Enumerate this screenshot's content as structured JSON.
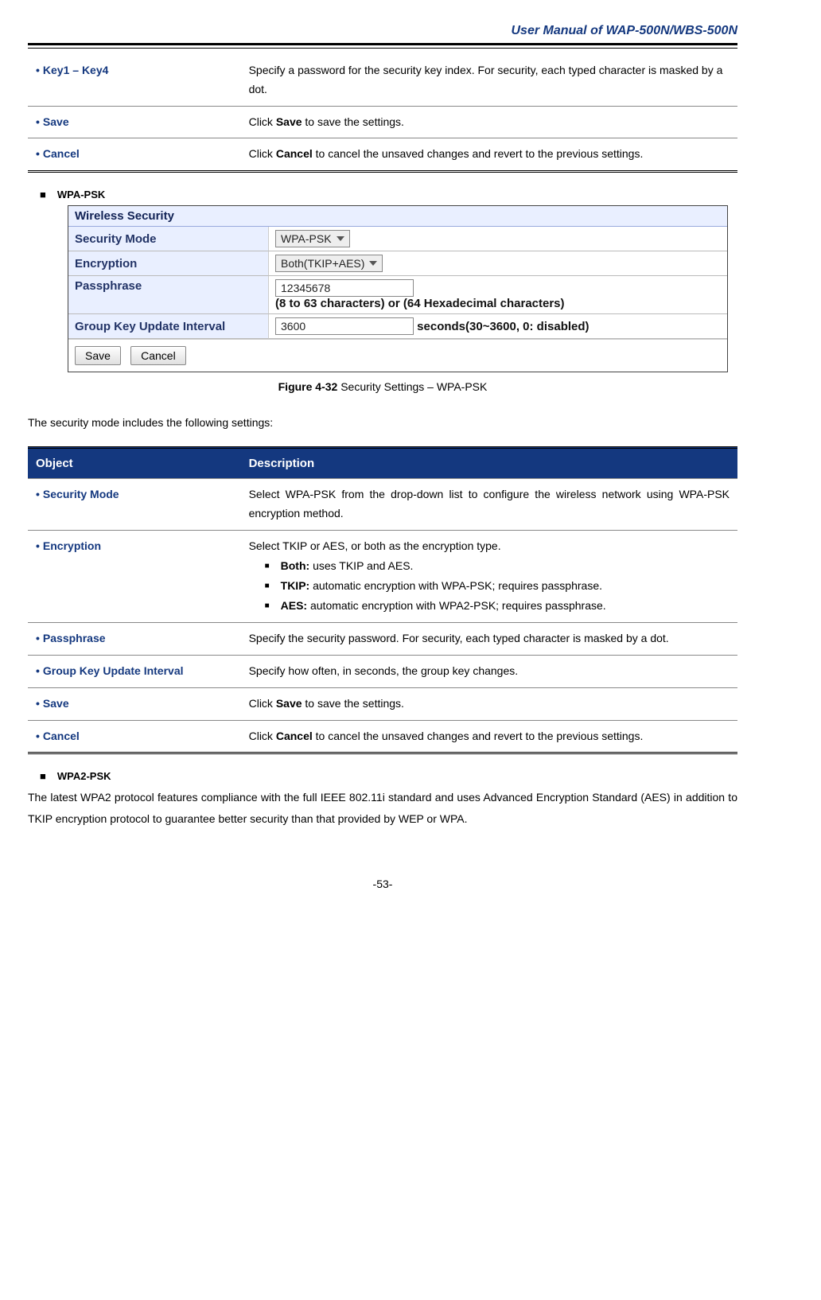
{
  "header": {
    "title": "User  Manual  of  WAP-500N/WBS-500N"
  },
  "table1": {
    "rows": [
      {
        "obj": "Key1 – Key4",
        "desc": "Specify a password for the security key index. For security, each typed character is masked by a dot."
      },
      {
        "obj": "Save",
        "desc_pre": "Click ",
        "desc_bold": "Save",
        "desc_post": " to save the settings."
      },
      {
        "obj": "Cancel",
        "desc_pre": "Click ",
        "desc_bold": "Cancel",
        "desc_post": " to cancel the unsaved changes and revert to the previous settings."
      }
    ]
  },
  "section1": {
    "title": "WPA-PSK"
  },
  "figure": {
    "header": "Wireless Security",
    "rows": {
      "security_mode": {
        "label": "Security Mode",
        "value": "WPA-PSK"
      },
      "encryption": {
        "label": "Encryption",
        "value": "Both(TKIP+AES)"
      },
      "passphrase": {
        "label": "Passphrase",
        "value": "12345678",
        "hint": "(8 to 63 characters) or (64 Hexadecimal characters)"
      },
      "interval": {
        "label": "Group Key Update Interval",
        "value": "3600",
        "hint": "seconds(30~3600, 0: disabled)"
      }
    },
    "buttons": {
      "save": "Save",
      "cancel": "Cancel"
    },
    "caption_bold": "Figure 4-32",
    "caption_rest": " Security Settings – WPA-PSK"
  },
  "intro2": "The security mode includes the following settings:",
  "table2": {
    "head_obj": "Object",
    "head_desc": "Description",
    "rows": {
      "security_mode": {
        "obj": "Security Mode",
        "desc": "Select  WPA-PSK  from  the  drop-down  list  to  configure  the  wireless network using WPA-PSK encryption method."
      },
      "encryption": {
        "obj": "Encryption",
        "lead": "Select TKIP or AES, or both as the encryption type.",
        "items": [
          {
            "b": "Both:",
            "t": " uses TKIP and AES."
          },
          {
            "b": "TKIP:",
            "t": " automatic encryption with WPA-PSK; requires passphrase."
          },
          {
            "b": "AES:",
            "t": " automatic encryption with WPA2-PSK; requires passphrase."
          }
        ]
      },
      "passphrase": {
        "obj": "Passphrase",
        "desc": "Specify  the  security  password.  For  security,  each  typed  character  is masked by a dot."
      },
      "interval": {
        "obj": "Group Key Update Interval",
        "desc": "Specify how often, in seconds, the group key changes."
      },
      "save": {
        "obj": "Save",
        "pre": "Click ",
        "bold": "Save",
        "post": " to save the settings."
      },
      "cancel": {
        "obj": "Cancel",
        "pre": "Click ",
        "bold": "Cancel",
        "post": " to cancel the unsaved changes and revert to the previous settings."
      }
    }
  },
  "section2": {
    "title": "WPA2-PSK",
    "text": "The  latest  WPA2  protocol  features  compliance  with  the  full  IEEE  802.11i  standard  and  uses  Advanced Encryption  Standard  (AES)  in  addition  to  TKIP  encryption  protocol  to  guarantee  better  security  than  that provided by WEP or WPA."
  },
  "page_number": "-53-"
}
